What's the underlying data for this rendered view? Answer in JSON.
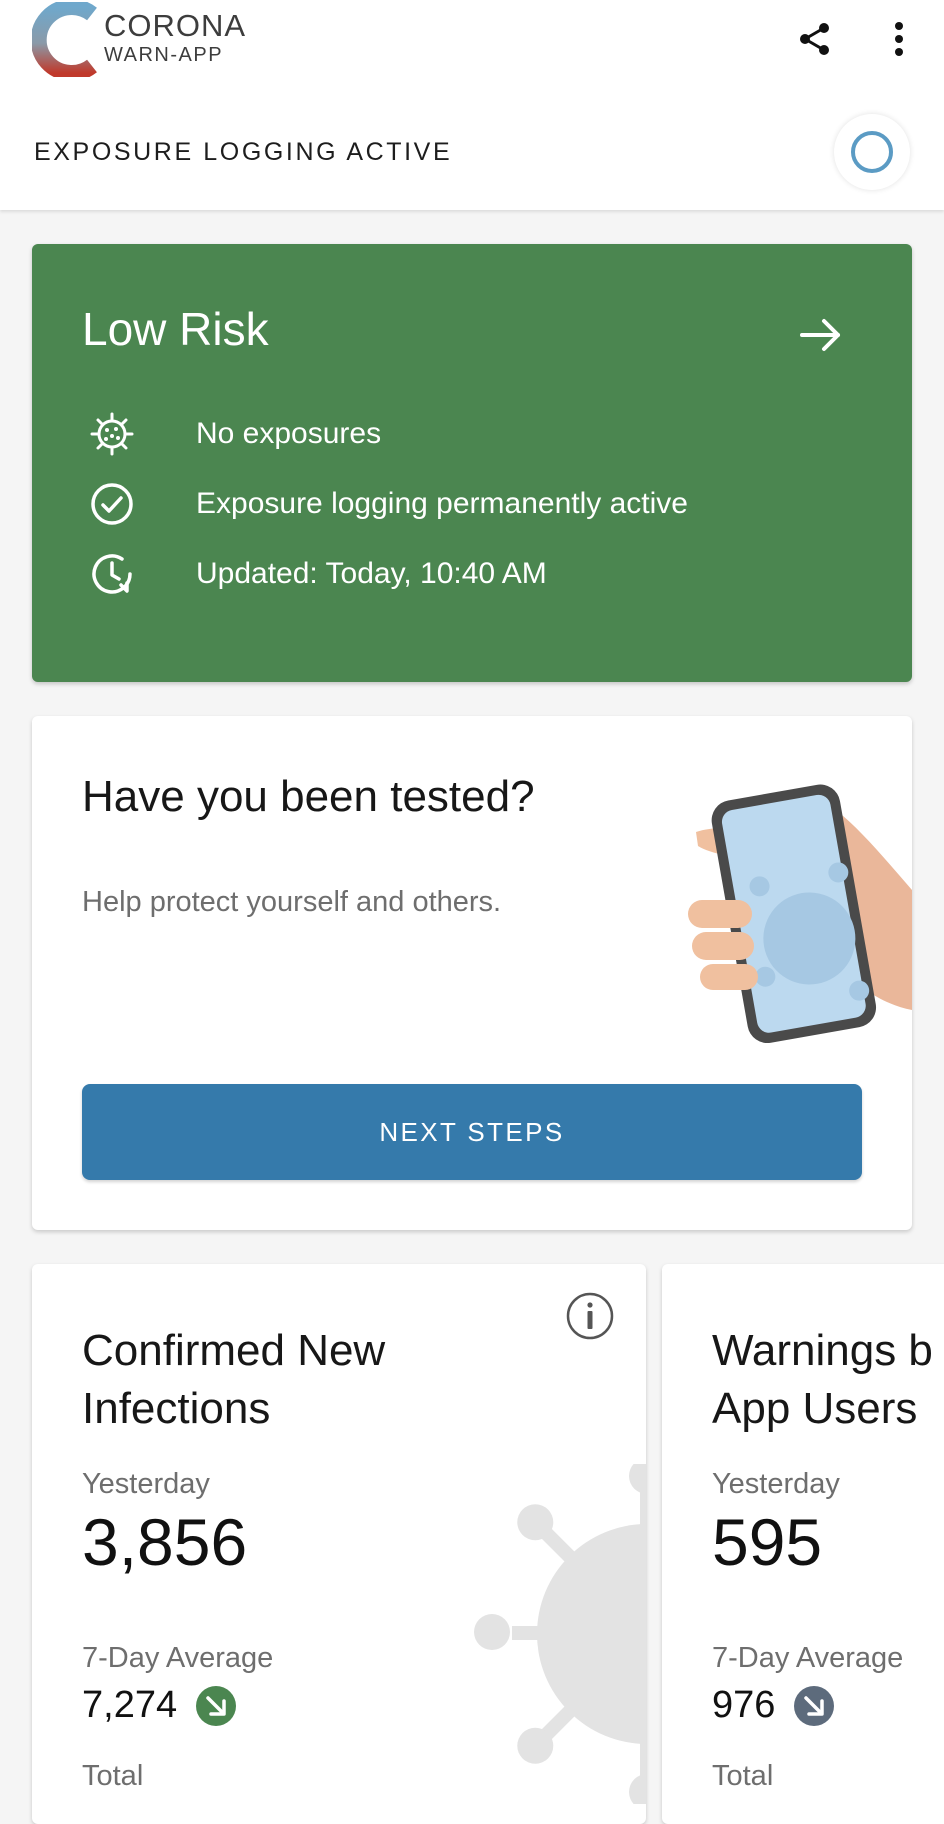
{
  "app": {
    "logo_title": "CORONA",
    "logo_subtitle": "WARN-APP"
  },
  "toolbar": {
    "share_icon": "share-icon",
    "more_icon": "more-vertical-icon"
  },
  "status": {
    "label": "EXPOSURE LOGGING ACTIVE",
    "indicator_color": "#5b9bc4"
  },
  "risk_card": {
    "title": "Low Risk",
    "background": "#4b8650",
    "rows": [
      {
        "icon": "virus-icon",
        "text": "No exposures"
      },
      {
        "icon": "check-circle-icon",
        "text": "Exposure logging permanently active"
      },
      {
        "icon": "clock-refresh-icon",
        "text": "Updated: Today, 10:40 AM"
      }
    ]
  },
  "test_card": {
    "title": "Have you been tested?",
    "subtitle": "Help protect yourself and others.",
    "button_label": "NEXT STEPS",
    "button_color": "#357aab"
  },
  "statistics": [
    {
      "title_line1": "Confirmed New",
      "title_line2": "Infections",
      "yesterday_label": "Yesterday",
      "yesterday_value": "3,856",
      "average_label": "7-Day Average",
      "average_value": "7,274",
      "trend": "down",
      "trend_color": "#4b8650",
      "total_label": "Total"
    },
    {
      "title_line1": "Warnings b",
      "title_line2": "App Users",
      "yesterday_label": "Yesterday",
      "yesterday_value": "595",
      "average_label": "7-Day Average",
      "average_value": "976",
      "trend": "down",
      "trend_color": "#5d6b7c",
      "total_label": "Total"
    }
  ]
}
